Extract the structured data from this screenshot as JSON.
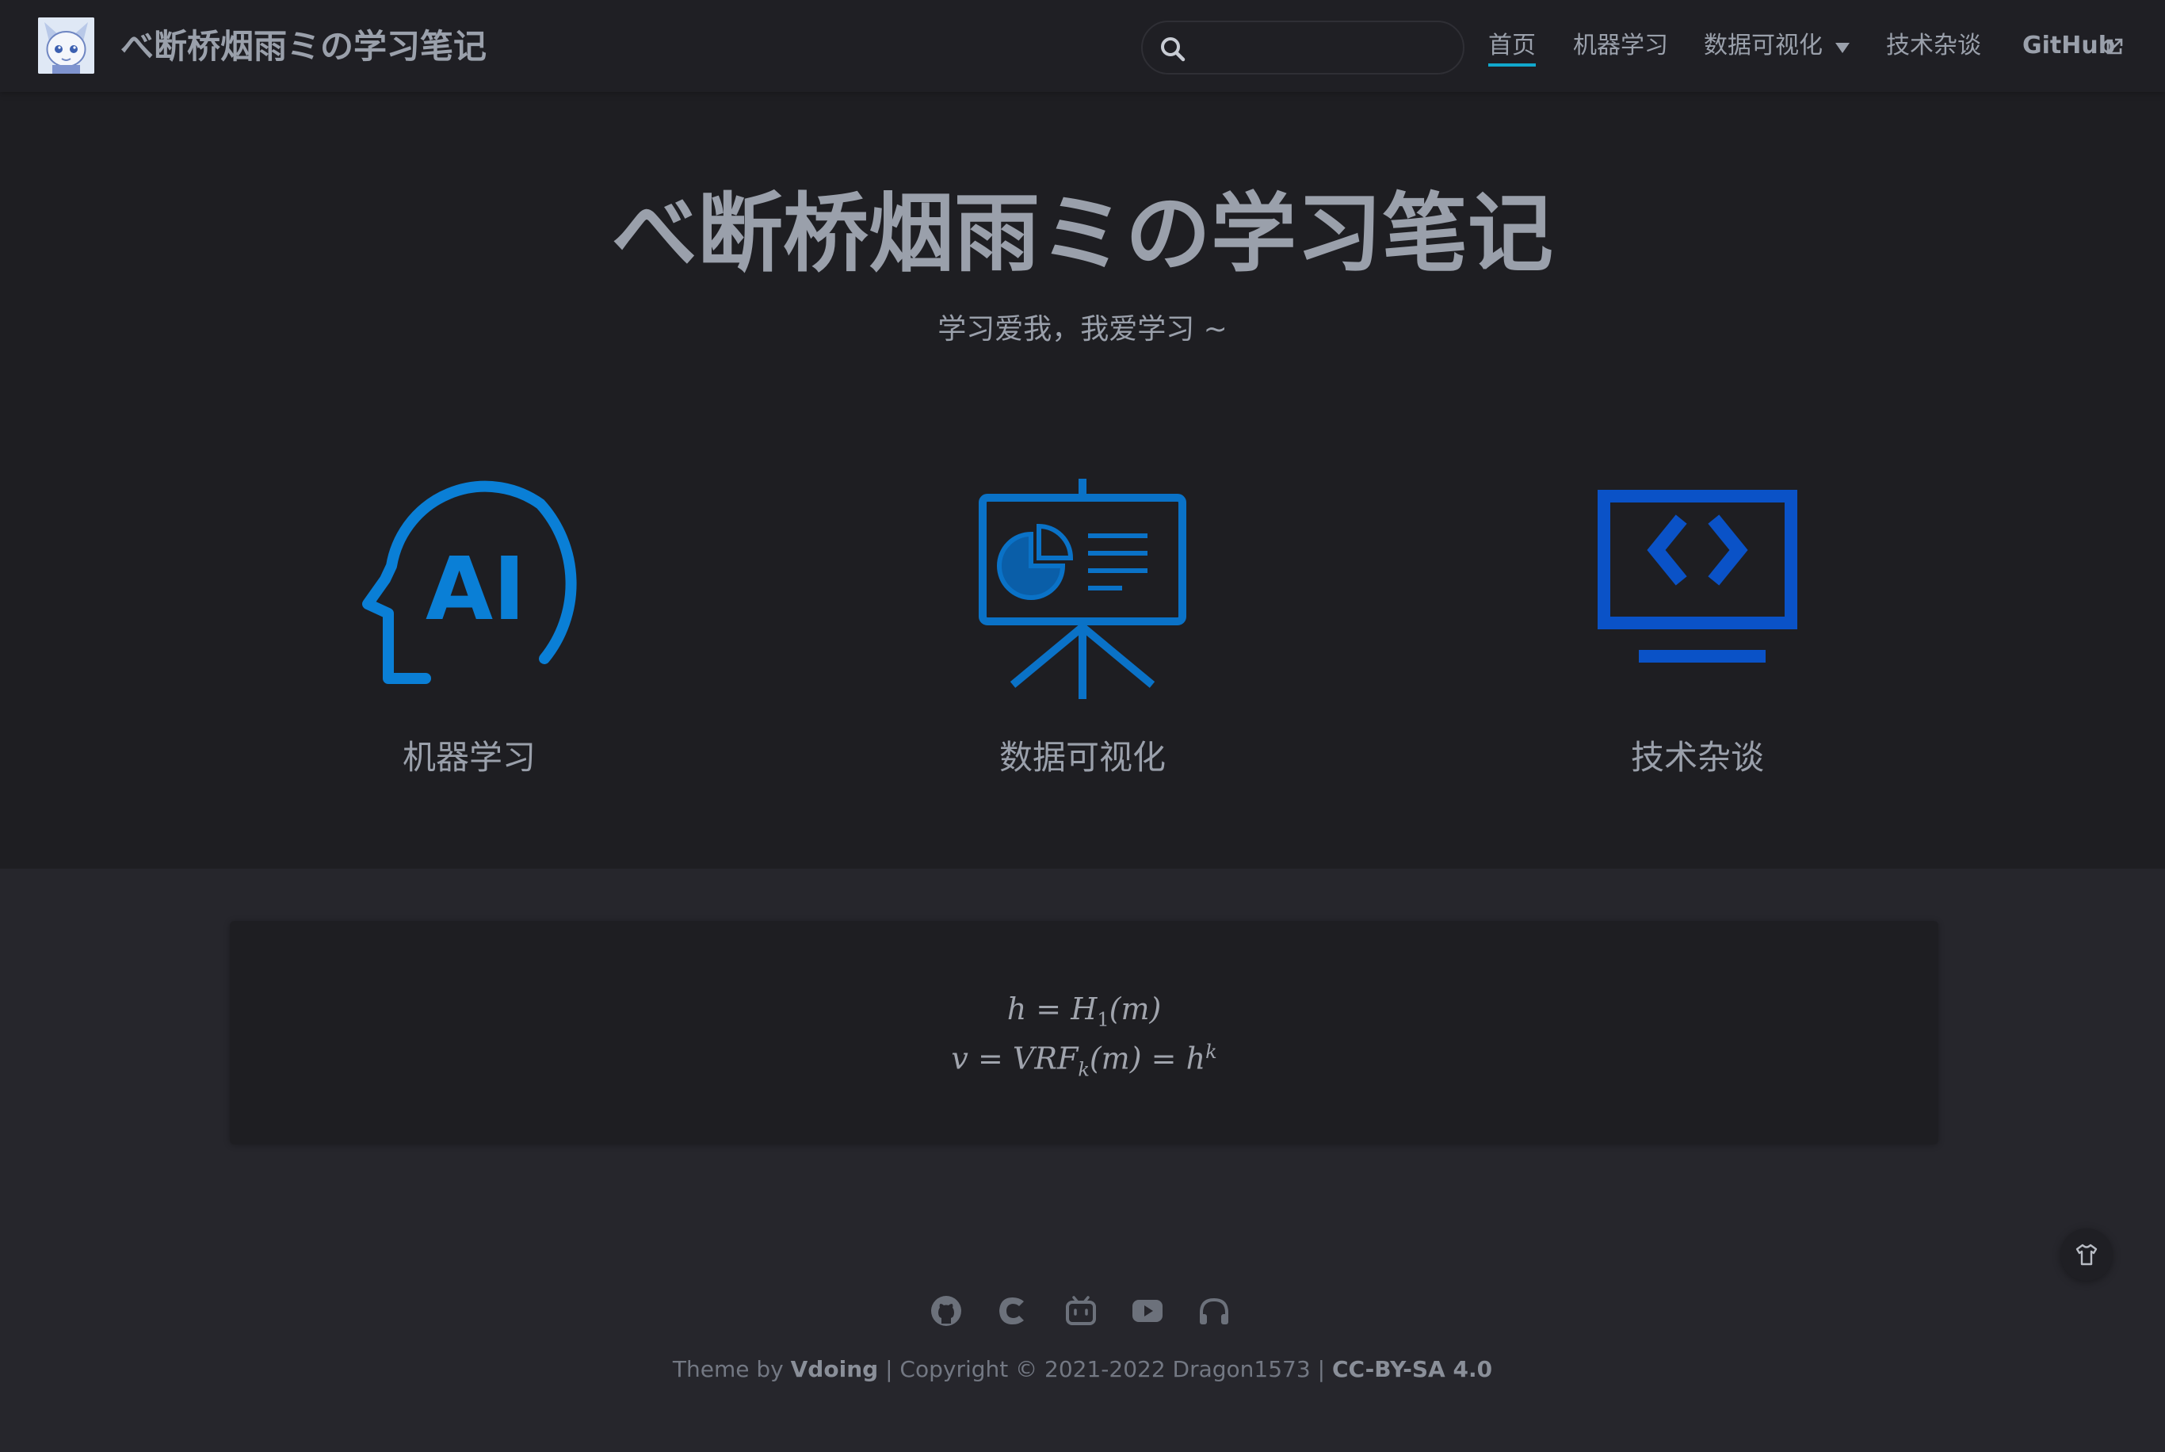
{
  "navbar": {
    "site_name": "べ断桥烟雨ミの学习笔记",
    "search": {
      "value": "",
      "placeholder": ""
    },
    "links": [
      {
        "label": "首页",
        "active": true
      },
      {
        "label": "机器学习"
      },
      {
        "label": "数据可视化",
        "has_dropdown": true
      },
      {
        "label": "技术杂谈"
      },
      {
        "label": "GitHub",
        "external": true
      }
    ]
  },
  "hero": {
    "title": "べ断桥烟雨ミの学习笔记",
    "description": "学习爱我，我爱学习 ~"
  },
  "features": [
    {
      "label": "机器学习",
      "icon": "ai-head-icon",
      "color": "#0a7fd6"
    },
    {
      "label": "数据可视化",
      "icon": "presentation-board-icon",
      "color": "#0a72c7"
    },
    {
      "label": "技术杂谈",
      "icon": "code-monitor-icon",
      "color": "#0a52c7"
    }
  ],
  "formula": {
    "line1_lhs": "h",
    "line1_eq": "=",
    "line1_fn": "H",
    "line1_sub": "1",
    "line1_arg": "(m)",
    "line2_lhs": "v",
    "line2_eq": "=",
    "line2_fn": "VRF",
    "line2_sub": "k",
    "line2_arg": "(m)",
    "line2_eq2": "=",
    "line2_base": "h",
    "line2_sup": "k"
  },
  "footer": {
    "icons": [
      "github-icon",
      "csdn-icon",
      "bilibili-icon",
      "youtube-icon",
      "music-icon"
    ],
    "theme_prefix": "Theme by",
    "theme_name": "Vdoing",
    "copyright": "| Copyright © 2021-2022 Dragon1573 |",
    "license": "CC-BY-SA 4.0"
  },
  "colors": {
    "navbar_bg": "#1f1f24",
    "hero_bg": "#1e1e22",
    "page_bg": "#26262c",
    "text": "#9aa0ab",
    "accent": "#11a8cd"
  }
}
